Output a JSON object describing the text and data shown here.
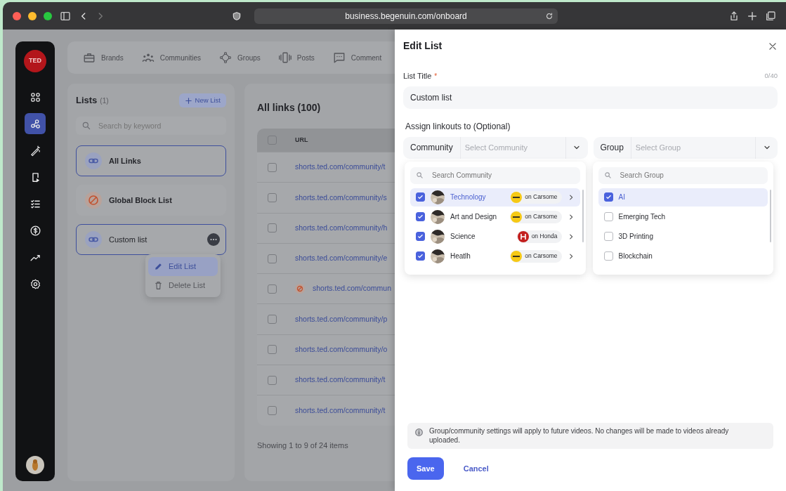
{
  "browser": {
    "url": "business.begenuin.com/onboard"
  },
  "sidebar": {
    "logo": "TED",
    "items": [
      {
        "kind": "apps",
        "selected": false
      },
      {
        "kind": "nodes",
        "selected": true
      },
      {
        "kind": "wand",
        "selected": false
      },
      {
        "kind": "video",
        "selected": false
      },
      {
        "kind": "checklist",
        "selected": false
      },
      {
        "kind": "dollar",
        "selected": false
      },
      {
        "kind": "trend",
        "selected": false
      },
      {
        "kind": "gear",
        "selected": false
      }
    ]
  },
  "top_nav": [
    {
      "label": "Brands",
      "kind": "briefcase"
    },
    {
      "label": "Communities",
      "kind": "people"
    },
    {
      "label": "Groups",
      "kind": "groups"
    },
    {
      "label": "Posts",
      "kind": "posts"
    },
    {
      "label": "Comment",
      "kind": "comment"
    }
  ],
  "lists_panel": {
    "title": "Lists",
    "count": "(1)",
    "new_button": "New List",
    "search": {
      "placeholder": "Search by keyword"
    },
    "items": [
      {
        "label": "All Links",
        "kind": "link",
        "selected": true,
        "menu": false
      },
      {
        "label": "Global Block List",
        "kind": "block",
        "selected": false,
        "menu": false
      },
      {
        "label": "Custom list",
        "kind": "link",
        "selected": true,
        "menu": true
      }
    ],
    "context_menu": [
      {
        "label": "Edit List",
        "kind": "edit",
        "selected": true
      },
      {
        "label": "Delete List",
        "kind": "delete",
        "selected": false
      }
    ]
  },
  "links_panel": {
    "title": "All links (100)",
    "all_checked": false,
    "columns": [
      "URL"
    ],
    "rows": [
      {
        "url": "shorts.ted.com/community/t",
        "blocked": false,
        "checked": false
      },
      {
        "url": "shorts.ted.com/community/s",
        "blocked": false,
        "checked": false
      },
      {
        "url": "shorts.ted.com/community/h",
        "blocked": false,
        "checked": false
      },
      {
        "url": "shorts.ted.com/community/e",
        "blocked": false,
        "checked": false
      },
      {
        "url": "shorts.ted.com/commun",
        "blocked": true,
        "checked": false
      },
      {
        "url": "shorts.ted.com/community/p",
        "blocked": false,
        "checked": false
      },
      {
        "url": "shorts.ted.com/community/o",
        "blocked": false,
        "checked": false
      },
      {
        "url": "shorts.ted.com/community/t",
        "blocked": false,
        "checked": false
      },
      {
        "url": "shorts.ted.com/community/t",
        "blocked": false,
        "checked": false
      }
    ],
    "footer": "Showing 1 to 9 of 24 items"
  },
  "drawer": {
    "title": "Edit List",
    "title_field": {
      "label": "List Title",
      "required_mark": "*",
      "counter": "0/40",
      "value": "Custom list"
    },
    "assign_label": "Assign linkouts to (Optional)",
    "community_select": {
      "label": "Community",
      "placeholder": "Select Community"
    },
    "group_select": {
      "label": "Group",
      "placeholder": "Select Group"
    },
    "community_dropdown": {
      "search_placeholder": "Search Community",
      "items": [
        {
          "name": "Technology",
          "checked": true,
          "selected": true,
          "brand": "on Carsome",
          "kind": "carsome"
        },
        {
          "name": "Art and Design",
          "checked": true,
          "selected": false,
          "brand": "on Carsome",
          "kind": "carsome"
        },
        {
          "name": "Science",
          "checked": true,
          "selected": false,
          "brand": "on Honda",
          "kind": "honda"
        },
        {
          "name": "Heatlh",
          "checked": true,
          "selected": false,
          "brand": "on Carsome",
          "kind": "carsome"
        }
      ]
    },
    "group_dropdown": {
      "search_placeholder": "Search Group",
      "items": [
        {
          "name": "AI",
          "checked": true,
          "selected": true
        },
        {
          "name": "Emerging Tech",
          "checked": false,
          "selected": false
        },
        {
          "name": "3D Printing",
          "checked": false,
          "selected": false
        },
        {
          "name": "Blockchain",
          "checked": false,
          "selected": false
        }
      ]
    },
    "notice": "Group/community settings will apply to future videos. No changes will be made to videos already uploaded.",
    "save": "Save",
    "cancel": "Cancel"
  }
}
